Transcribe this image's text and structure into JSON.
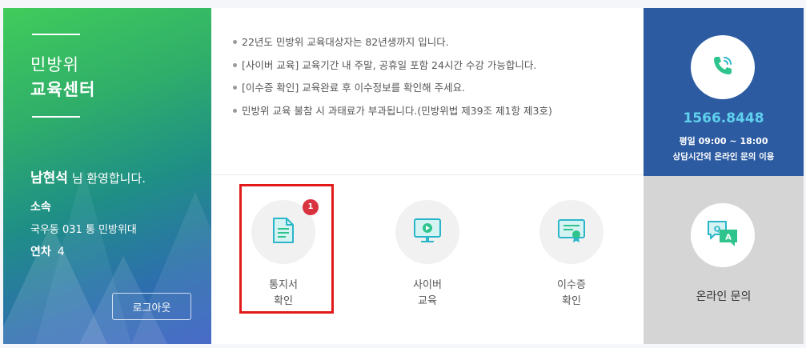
{
  "profile": {
    "title_line1": "민방위",
    "title_line2": "교육센터",
    "user_name": "남현석",
    "welcome_suffix": " 님 환영합니다.",
    "affiliation_label": "소속",
    "affiliation_value": "국우동 031 통 민방위대",
    "year_label": "연차",
    "year_value": "4",
    "logout_label": "로그아웃"
  },
  "notices": [
    "22년도 민방위 교육대상자는 82년생까지 입니다.",
    "[사이버 교육] 교육기간 내 주말, 공휴일 포함 24시간 수강 가능합니다.",
    "[이수증 확인] 교육완료 후 이수정보를 확인해 주세요.",
    "민방위 교육 불참 시 과태료가 부과됩니다.(민방위법 제39조 제1항 제3호)"
  ],
  "menu": {
    "notice": {
      "line1": "통지서",
      "line2": "확인",
      "badge": "1",
      "icon": "document-icon"
    },
    "cyber": {
      "line1": "사이버",
      "line2": "교육",
      "icon": "monitor-play-icon"
    },
    "certificate": {
      "line1": "이수증",
      "line2": "확인",
      "icon": "certificate-icon"
    }
  },
  "contact": {
    "phone": "1566.8448",
    "hours": "평일 09:00 ~ 18:00",
    "note": "상담시간외 온라인 문의 이용",
    "icon": "phone-icon"
  },
  "inquiry": {
    "label": "온라인 문의",
    "icon": "qa-chat-icon"
  },
  "colors": {
    "contact_bg": "#2c5ba1",
    "phone_text": "#5fd0ee",
    "inquiry_bg": "#d5d5d5",
    "badge": "#d9333f",
    "highlight": "#e21a1a",
    "icon_teal": "#2bb5c9",
    "icon_green": "#2fc48d"
  }
}
